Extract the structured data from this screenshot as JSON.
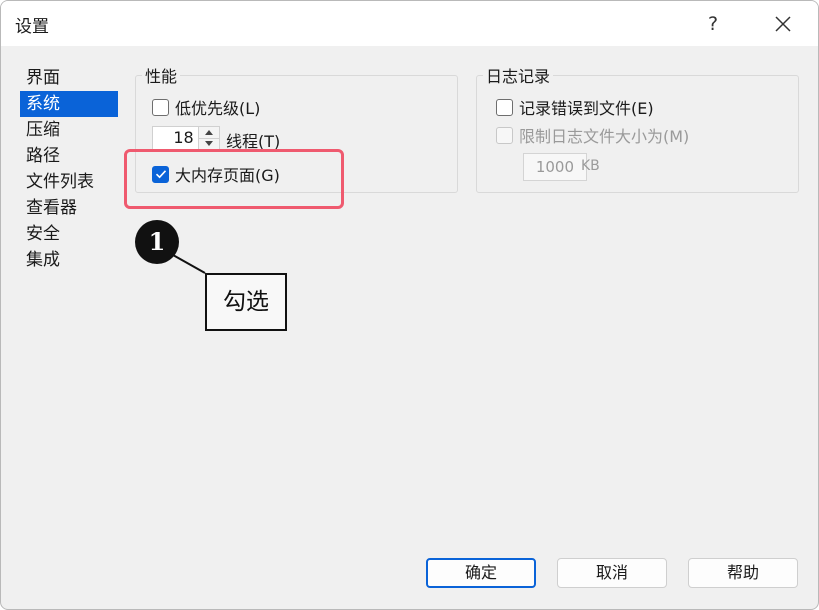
{
  "window": {
    "title": "设置",
    "help_glyph": "?"
  },
  "nav": {
    "items": [
      {
        "label": "界面",
        "selected": false
      },
      {
        "label": "系统",
        "selected": true
      },
      {
        "label": "压缩",
        "selected": false
      },
      {
        "label": "路径",
        "selected": false
      },
      {
        "label": "文件列表",
        "selected": false
      },
      {
        "label": "查看器",
        "selected": false
      },
      {
        "label": "安全",
        "selected": false
      },
      {
        "label": "集成",
        "selected": false
      }
    ]
  },
  "performance": {
    "title": "性能",
    "low_priority": {
      "label": "低优先级(L)",
      "checked": false
    },
    "threads": {
      "value": "18",
      "label": "线程(T)"
    },
    "large_pages": {
      "label": "大内存页面(G)",
      "checked": true
    }
  },
  "logging": {
    "title": "日志记录",
    "log_errors": {
      "label": "记录错误到文件(E)",
      "checked": false
    },
    "limit_size": {
      "label": "限制日志文件大小为(M)",
      "checked": false,
      "enabled": false
    },
    "size_value": "1000",
    "size_unit": "KB"
  },
  "annotation": {
    "number": "1",
    "text": "勾选",
    "highlight_color": "#ef5a6f"
  },
  "buttons": {
    "ok": "确定",
    "cancel": "取消",
    "help": "帮助"
  },
  "colors": {
    "accent": "#0a63d8",
    "window_bg": "#f0f0f0"
  }
}
